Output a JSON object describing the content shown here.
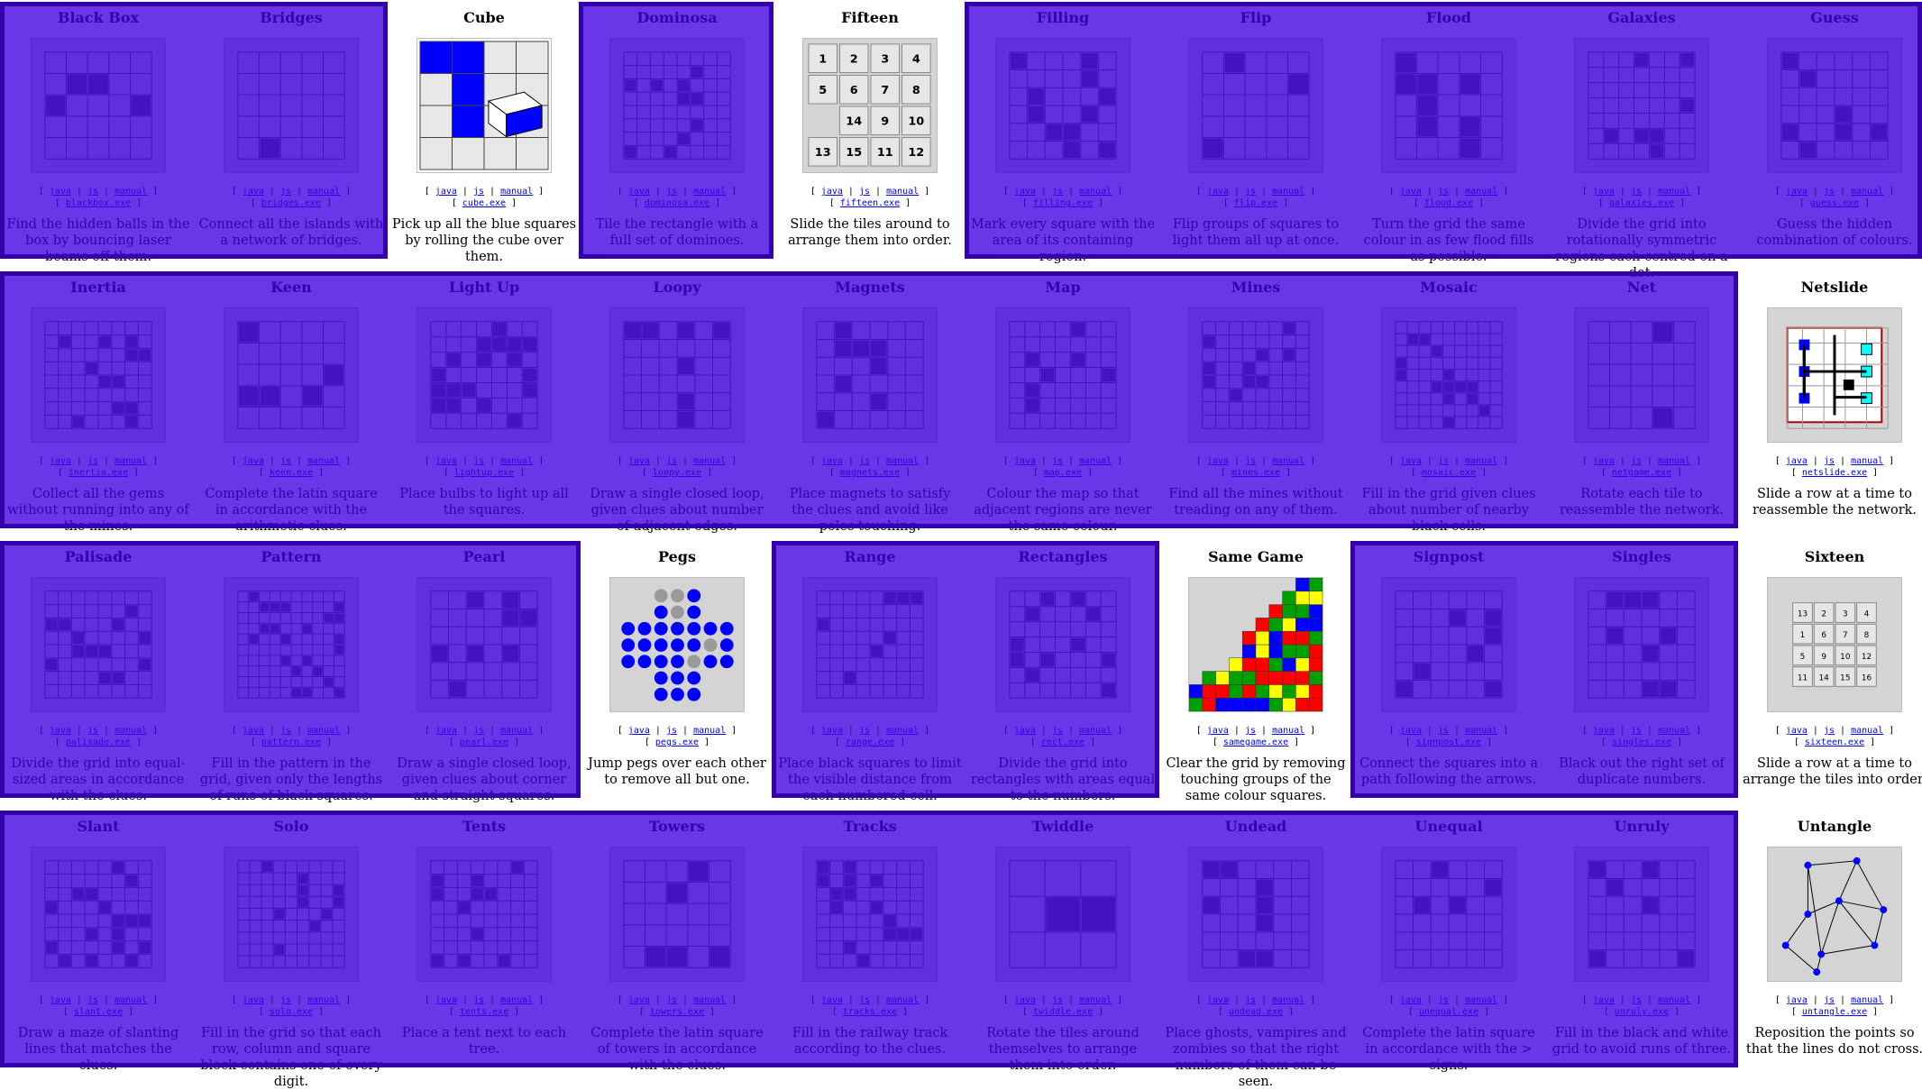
{
  "link_labels": {
    "java": "java",
    "js": "js",
    "manual": "manual"
  },
  "games": [
    {
      "title": "Black Box",
      "exe": "blackbox.exe",
      "desc": "Find the hidden balls in the box by bouncing laser beams off them.",
      "icon": "black-box-thumbnail"
    },
    {
      "title": "Bridges",
      "exe": "bridges.exe",
      "desc": "Connect all the islands with a network of bridges.",
      "icon": "bridges-thumbnail"
    },
    {
      "title": "Cube",
      "exe": "cube.exe",
      "desc": "Pick up all the blue squares by rolling the cube over them.",
      "icon": "cube-thumbnail"
    },
    {
      "title": "Dominosa",
      "exe": "dominosa.exe",
      "desc": "Tile the rectangle with a full set of dominoes.",
      "icon": "dominosa-thumbnail"
    },
    {
      "title": "Fifteen",
      "exe": "fifteen.exe",
      "desc": "Slide the tiles around to arrange them into order.",
      "icon": "fifteen-thumbnail"
    },
    {
      "title": "Filling",
      "exe": "filling.exe",
      "desc": "Mark every square with the area of its containing region.",
      "icon": "filling-thumbnail"
    },
    {
      "title": "Flip",
      "exe": "flip.exe",
      "desc": "Flip groups of squares to light them all up at once.",
      "icon": "flip-thumbnail"
    },
    {
      "title": "Flood",
      "exe": "flood.exe",
      "desc": "Turn the grid the same colour in as few flood fills as possible.",
      "icon": "flood-thumbnail"
    },
    {
      "title": "Galaxies",
      "exe": "galaxies.exe",
      "desc": "Divide the grid into rotationally symmetric regions each centred on a dot.",
      "icon": "galaxies-thumbnail"
    },
    {
      "title": "Guess",
      "exe": "guess.exe",
      "desc": "Guess the hidden combination of colours.",
      "icon": "guess-thumbnail"
    },
    {
      "title": "Inertia",
      "exe": "inertia.exe",
      "desc": "Collect all the gems without running into any of the mines.",
      "icon": "inertia-thumbnail"
    },
    {
      "title": "Keen",
      "exe": "keen.exe",
      "desc": "Complete the latin square in accordance with the arithmetic clues.",
      "icon": "keen-thumbnail"
    },
    {
      "title": "Light Up",
      "exe": "lightup.exe",
      "desc": "Place bulbs to light up all the squares.",
      "icon": "lightup-thumbnail"
    },
    {
      "title": "Loopy",
      "exe": "loopy.exe",
      "desc": "Draw a single closed loop, given clues about number of adjacent edges.",
      "icon": "loopy-thumbnail"
    },
    {
      "title": "Magnets",
      "exe": "magnets.exe",
      "desc": "Place magnets to satisfy the clues and avoid like poles touching.",
      "icon": "magnets-thumbnail"
    },
    {
      "title": "Map",
      "exe": "map.exe",
      "desc": "Colour the map so that adjacent regions are never the same colour.",
      "icon": "map-thumbnail"
    },
    {
      "title": "Mines",
      "exe": "mines.exe",
      "desc": "Find all the mines without treading on any of them.",
      "icon": "mines-thumbnail"
    },
    {
      "title": "Mosaic",
      "exe": "mosaic.exe",
      "desc": "Fill in the grid given clues about number of nearby black cells.",
      "icon": "mosaic-thumbnail"
    },
    {
      "title": "Net",
      "exe": "netgame.exe",
      "desc": "Rotate each tile to reassemble the network.",
      "icon": "net-thumbnail"
    },
    {
      "title": "Netslide",
      "exe": "netslide.exe",
      "desc": "Slide a row at a time to reassemble the network.",
      "icon": "netslide-thumbnail"
    },
    {
      "title": "Palisade",
      "exe": "palisade.exe",
      "desc": "Divide the grid into equal-sized areas in accordance with the clues.",
      "icon": "palisade-thumbnail"
    },
    {
      "title": "Pattern",
      "exe": "pattern.exe",
      "desc": "Fill in the pattern in the grid, given only the lengths of runs of black squares.",
      "icon": "pattern-thumbnail"
    },
    {
      "title": "Pearl",
      "exe": "pearl.exe",
      "desc": "Draw a single closed loop, given clues about corner and straight squares.",
      "icon": "pearl-thumbnail"
    },
    {
      "title": "Pegs",
      "exe": "pegs.exe",
      "desc": "Jump pegs over each other to remove all but one.",
      "icon": "pegs-thumbnail"
    },
    {
      "title": "Range",
      "exe": "range.exe",
      "desc": "Place black squares to limit the visible distance from each numbered cell.",
      "icon": "range-thumbnail"
    },
    {
      "title": "Rectangles",
      "exe": "rect.exe",
      "desc": "Divide the grid into rectangles with areas equal to the numbers.",
      "icon": "rectangles-thumbnail"
    },
    {
      "title": "Same Game",
      "exe": "samegame.exe",
      "desc": "Clear the grid by removing touching groups of the same colour squares.",
      "icon": "samegame-thumbnail"
    },
    {
      "title": "Signpost",
      "exe": "signpost.exe",
      "desc": "Connect the squares into a path following the arrows.",
      "icon": "signpost-thumbnail"
    },
    {
      "title": "Singles",
      "exe": "singles.exe",
      "desc": "Black out the right set of duplicate numbers.",
      "icon": "singles-thumbnail"
    },
    {
      "title": "Sixteen",
      "exe": "sixteen.exe",
      "desc": "Slide a row at a time to arrange the tiles into order.",
      "icon": "sixteen-thumbnail"
    },
    {
      "title": "Slant",
      "exe": "slant.exe",
      "desc": "Draw a maze of slanting lines that matches the clues.",
      "icon": "slant-thumbnail"
    },
    {
      "title": "Solo",
      "exe": "solo.exe",
      "desc": "Fill in the grid so that each row, column and square block contains one of every digit.",
      "icon": "solo-thumbnail"
    },
    {
      "title": "Tents",
      "exe": "tents.exe",
      "desc": "Place a tent next to each tree.",
      "icon": "tents-thumbnail"
    },
    {
      "title": "Towers",
      "exe": "towers.exe",
      "desc": "Complete the latin square of towers in accordance with the clues.",
      "icon": "towers-thumbnail"
    },
    {
      "title": "Tracks",
      "exe": "tracks.exe",
      "desc": "Fill in the railway track according to the clues.",
      "icon": "tracks-thumbnail"
    },
    {
      "title": "Twiddle",
      "exe": "twiddle.exe",
      "desc": "Rotate the tiles around themselves to arrange them into order.",
      "icon": "twiddle-thumbnail"
    },
    {
      "title": "Undead",
      "exe": "undead.exe",
      "desc": "Place ghosts, vampires and zombies so that the right numbers of them can be seen.",
      "icon": "undead-thumbnail"
    },
    {
      "title": "Unequal",
      "exe": "unequal.exe",
      "desc": "Complete the latin square in accordance with the > signs.",
      "icon": "unequal-thumbnail"
    },
    {
      "title": "Unruly",
      "exe": "unruly.exe",
      "desc": "Fill in the black and white grid to avoid runs of three.",
      "icon": "unruly-thumbnail"
    },
    {
      "title": "Untangle",
      "exe": "untangle.exe",
      "desc": "Reposition the points so that the lines do not cross.",
      "icon": "untangle-thumbnail"
    }
  ],
  "colors": {
    "overlay_fill": "#4000e0",
    "overlay_border": "#3300aa",
    "link": "#0000ee",
    "cube_blue": "#0000ff",
    "peg_blue": "#0000ff",
    "netslide_cyan": "#00ffff"
  },
  "highlight_groups": [
    {
      "name": "row1-left",
      "row": 0,
      "from": 0,
      "to": 1
    },
    {
      "name": "row1-mid",
      "row": 0,
      "from": 3,
      "to": 3
    },
    {
      "name": "row1-right",
      "row": 0,
      "from": 5,
      "to": 9
    },
    {
      "name": "row2",
      "row": 1,
      "from": 0,
      "to": 8
    },
    {
      "name": "row3-left",
      "row": 2,
      "from": 0,
      "to": 2
    },
    {
      "name": "row3-mid",
      "row": 2,
      "from": 4,
      "to": 5
    },
    {
      "name": "row3-right",
      "row": 2,
      "from": 7,
      "to": 8
    },
    {
      "name": "row4",
      "row": 3,
      "from": 0,
      "to": 8
    }
  ]
}
